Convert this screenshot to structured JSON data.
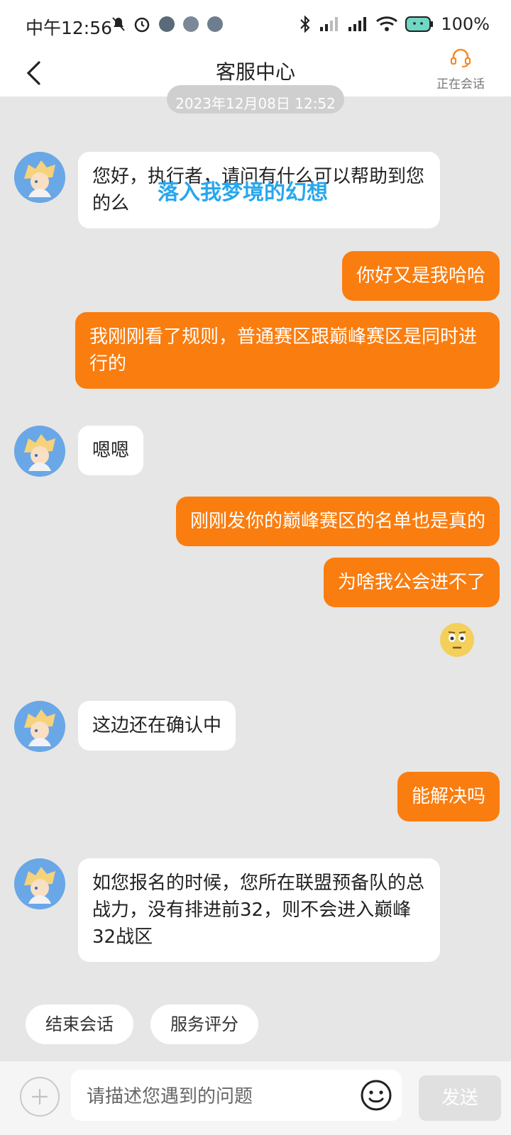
{
  "status_bar": {
    "time": "中午12:56",
    "battery": "100%"
  },
  "header": {
    "title": "客服中心",
    "status_label": "正在会话"
  },
  "chat": {
    "timestamp": "2023年12月08日 12:52",
    "overlay_text": "落入我梦境的幻想",
    "messages": [
      {
        "from": "agent",
        "text": "您好，执行者，请问有什么可以帮助到您的么"
      },
      {
        "from": "user",
        "text": "你好又是我哈哈"
      },
      {
        "from": "user",
        "text": "我刚刚看了规则，普通赛区跟巅峰赛区是同时进行的"
      },
      {
        "from": "agent",
        "text": "嗯嗯"
      },
      {
        "from": "user",
        "text": "刚刚发你的巅峰赛区的名单也是真的"
      },
      {
        "from": "user",
        "text": "为啥我公会进不了"
      },
      {
        "from": "user",
        "text": "[flushed-emoji]"
      },
      {
        "from": "agent",
        "text": "这边还在确认中"
      },
      {
        "from": "user",
        "text": "能解决吗"
      },
      {
        "from": "agent",
        "text": "如您报名的时候，您所在联盟预备队的总战力，没有排进前32，则不会进入巅峰32战区"
      }
    ]
  },
  "actions": {
    "end_session": "结束会话",
    "rate_service": "服务评分"
  },
  "input": {
    "placeholder": "请描述您遇到的问题",
    "send_label": "发送"
  },
  "colors": {
    "accent": "#fa7d0f",
    "background": "#e6e6e6",
    "overlay": "#27a7ee"
  }
}
